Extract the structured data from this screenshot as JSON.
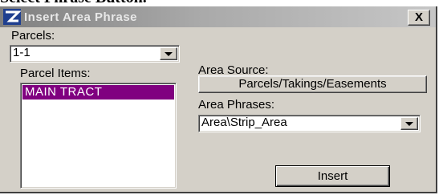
{
  "page_header": {
    "text": "Select Phrase Button."
  },
  "window": {
    "title": "Insert Area Phrase",
    "close_label": "X"
  },
  "parcels": {
    "label": "Parcels:",
    "value": "1-1"
  },
  "parcel_items": {
    "label": "Parcel Items:",
    "items": [
      "MAIN TRACT"
    ],
    "selected_index": 0
  },
  "area_source": {
    "label": "Area Source:",
    "button_label": "Parcels/Takings/Easements"
  },
  "area_phrases": {
    "label": "Area Phrases:",
    "value": "Area\\Strip_Area"
  },
  "actions": {
    "insert_label": "Insert"
  },
  "colors": {
    "selection": "#800080",
    "dialog_face": "#d4d0c8",
    "titlebar": "#a9a9a9"
  }
}
